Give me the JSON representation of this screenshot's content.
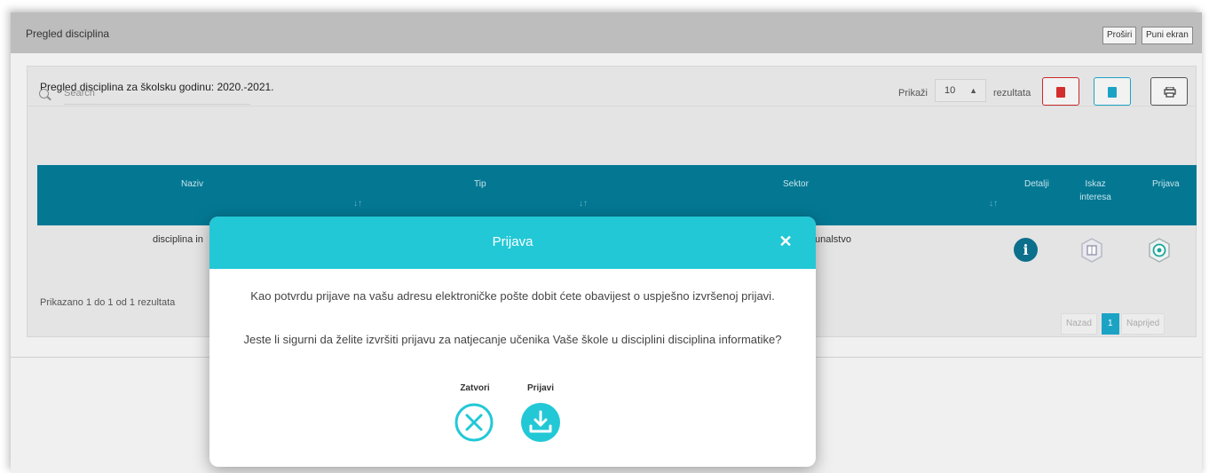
{
  "panel": {
    "title": "Pregled disciplina",
    "btn_expand": "Proširi",
    "btn_fullscreen": "Puni ekran"
  },
  "card": {
    "title": "Pregled disciplina za školsku godinu: 2020.-2021."
  },
  "search": {
    "placeholder": "Search"
  },
  "page_size": {
    "label_before": "Prikaži",
    "value": "10",
    "label_after": "rezultata"
  },
  "table": {
    "columns": [
      "Naziv",
      "Tip",
      "Sektor",
      "Detalji",
      "Iskaz interesa",
      "Prijava"
    ],
    "rows": [
      {
        "naziv": "disciplina in",
        "sektor": "unalstvo"
      }
    ]
  },
  "summary": "Prikazano 1 do 1 od 1 rezultata",
  "pagination": {
    "prev": "Nazad",
    "current": "1",
    "next": "Naprijed"
  },
  "modal": {
    "title": "Prijava",
    "message_1": "Kao potvrdu prijave na vašu adresu elektroničke pošte dobit ćete obavijest o uspješno izvršenoj prijavi.",
    "message_2": "Jeste li sigurni da želite izvršiti prijavu za natjecanje učenika Vaše škole u disciplini disciplina informatike?",
    "close_label": "Zatvori",
    "apply_label": "Prijavi"
  },
  "colors": {
    "header_bar": "#bdbdbd",
    "table_header": "#047893",
    "modal_accent": "#22c8d6",
    "pdf_red": "#d32f2f",
    "info_blue": "#0c6f8c"
  },
  "icons": [
    "search-icon",
    "pdf-icon",
    "excel-icon",
    "print-icon",
    "sort-icon",
    "info-icon",
    "interest-book-icon",
    "apply-badge-icon",
    "close-icon",
    "close-circle-icon",
    "download-icon"
  ]
}
